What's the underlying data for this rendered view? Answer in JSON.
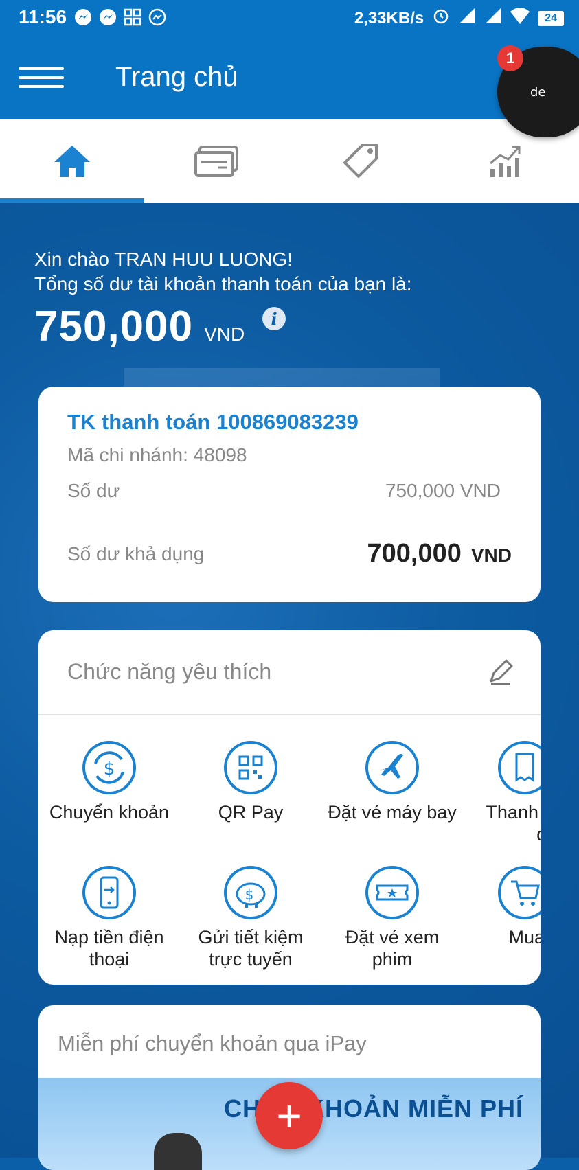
{
  "status_bar": {
    "time": "11:56",
    "network_speed": "2,33KB/s",
    "battery": "24",
    "icons": [
      "messenger-icon",
      "messenger-icon",
      "qr-app-icon",
      "messenger-outline-icon",
      "alarm-icon",
      "signal-icon",
      "signal-icon",
      "wifi-icon",
      "battery-icon"
    ]
  },
  "header": {
    "title": "Trang chủ",
    "menu_icon": "hamburger-icon"
  },
  "chat_head": {
    "badge": "1",
    "label": "de"
  },
  "tabs": [
    {
      "name": "home",
      "icon": "home-icon",
      "active": true
    },
    {
      "name": "cards",
      "icon": "cards-icon",
      "active": false
    },
    {
      "name": "offers",
      "icon": "tag-icon",
      "active": false
    },
    {
      "name": "analytics",
      "icon": "chart-icon",
      "active": false
    }
  ],
  "greeting": {
    "line1": "Xin chào TRAN HUU LUONG!",
    "line2": "Tổng số dư tài khoản thanh toán của bạn là:",
    "amount": "750,000",
    "currency": "VND",
    "info_icon": "i"
  },
  "account": {
    "title": "TK thanh toán 100869083239",
    "branch": "Mã chi nhánh: 48098",
    "balance_label": "Số dư",
    "balance_value": "750,000 VND",
    "available_label": "Số dư khả dụng",
    "available_amount": "700,000",
    "available_currency": "VND"
  },
  "favorites": {
    "title": "Chức năng yêu thích",
    "edit_icon": "pencil-icon",
    "items": [
      {
        "label": "Chuyển khoản",
        "icon": "transfer-icon"
      },
      {
        "label": "QR Pay",
        "icon": "qr-icon"
      },
      {
        "label": "Đặt vé máy bay",
        "icon": "airplane-icon"
      },
      {
        "label": "Thanh to\nđơ",
        "icon": "bill-icon"
      },
      {
        "label": "Nạp tiền điện\nthoại",
        "icon": "phone-topup-icon"
      },
      {
        "label": "Gửi tiết kiệm\ntrực tuyến",
        "icon": "piggy-bank-icon"
      },
      {
        "label": "Đặt vé xem\nphim",
        "icon": "ticket-icon"
      },
      {
        "label": "Mua s",
        "icon": "cart-icon"
      }
    ]
  },
  "promo": {
    "title": "Miễn phí chuyển khoản qua iPay",
    "banner_text": "CH      KHOẢN MIỄN PHÍ"
  },
  "fab": {
    "label": "+"
  },
  "colors": {
    "primary": "#0a74c4",
    "accent": "#1a82d0",
    "fab": "#e53935"
  }
}
